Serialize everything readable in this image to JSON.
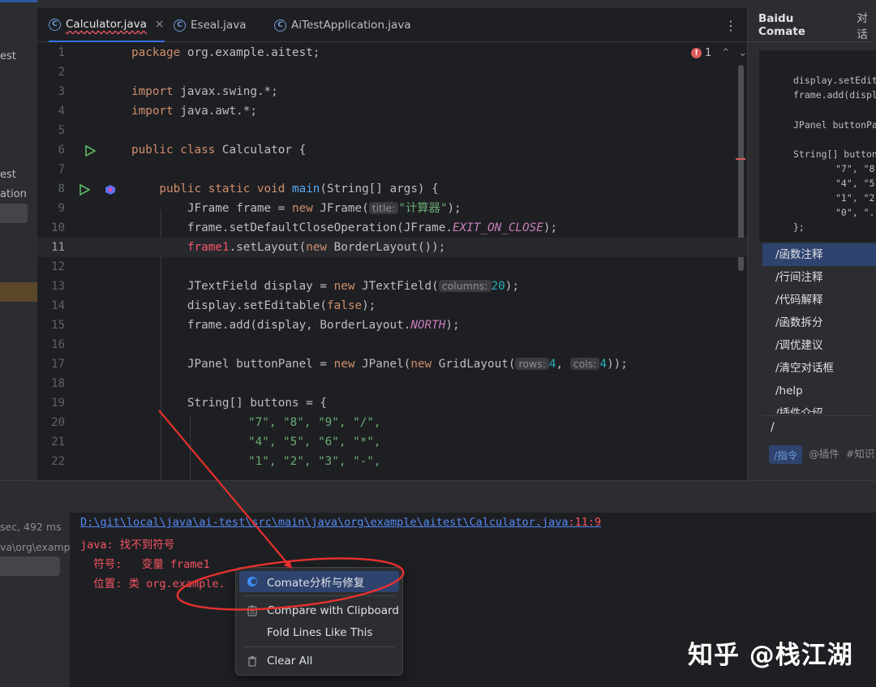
{
  "project_panel": {
    "items": [
      "est",
      "est",
      "ation"
    ]
  },
  "tabs": [
    {
      "label": "Calculator.java",
      "active": true,
      "has_error": true
    },
    {
      "label": "Eseal.java",
      "active": false,
      "has_error": false
    },
    {
      "label": "AiTestApplication.java",
      "active": false,
      "has_error": false
    }
  ],
  "editor": {
    "error_count": "1",
    "current_line": 11,
    "line_numbers": [
      "1",
      "2",
      "3",
      "4",
      "5",
      "6",
      "7",
      "8",
      "9",
      "10",
      "11",
      "12",
      "13",
      "14",
      "15",
      "16",
      "17",
      "18",
      "19",
      "20",
      "21",
      "22"
    ],
    "lines": {
      "l1a": "package",
      "l1b": " org.example.aitest;",
      "l3a": "import",
      "l3b": " javax.swing.*;",
      "l4a": "import",
      "l4b": " java.awt.*;",
      "l6a": "public class",
      "l6b": " Calculator {",
      "l8a": "    public static void ",
      "l8b": "main",
      "l8c": "(String[] args) {",
      "l9a": "        JFrame frame = ",
      "l9b": "new",
      "l9c": " JFrame(",
      "l9h": "title:",
      "l9s": "\"计算器\"",
      "l9d": ");",
      "l10a": "        frame.setDefaultCloseOperation(JFrame.",
      "l10b": "EXIT_ON_CLOSE",
      "l10c": ");",
      "l11a": "        ",
      "l11b": "frame1",
      "l11c": ".setLayout(",
      "l11d": "new",
      "l11e": " BorderLayout());",
      "l13a": "        JTextField display = ",
      "l13b": "new",
      "l13c": " JTextField(",
      "l13h": "columns:",
      "l13n": "20",
      "l13d": ");",
      "l14a": "        display.setEditable(",
      "l14b": "false",
      "l14c": ");",
      "l15a": "        frame.add(display, BorderLayout.",
      "l15b": "NORTH",
      "l15c": ");",
      "l17a": "        JPanel buttonPanel = ",
      "l17b": "new",
      "l17c": " JPanel(",
      "l17d": "new",
      "l17e": " GridLayout(",
      "l17h1": "rows:",
      "l17n1": "4",
      "l17m": ", ",
      "l17h2": "cols:",
      "l17n2": "4",
      "l17f": "));",
      "l19a": "        String[] buttons = {",
      "l20": "\"7\", \"8\", \"9\", \"/\",",
      "l21": "\"4\", \"5\", \"6\", \"*\",",
      "l22": "\"1\", \"2\", \"3\", \"-\","
    }
  },
  "right_panel": {
    "tab_active": "Baidu Comate",
    "tab_other": "对话",
    "code_lines": {
      "r1": "display.setEdita",
      "r1b": "frame.add(displa",
      "r2": "JPanel buttonPan",
      "r3": "String[] buttons",
      "r4": "\"7\", \"8\"",
      "r5": "\"4\", \"5\"",
      "r6": "\"1\", \"2\"",
      "r7": "\"0\", \".\"",
      "r8": "};"
    },
    "commands": [
      "/函数注释",
      "/行间注释",
      "/代码解释",
      "/函数拆分",
      "/调优建议",
      "/清空对话框",
      "/help",
      "/插件介绍"
    ],
    "input_value": "/",
    "chips": {
      "active": "/指令",
      "c2": "@插件",
      "c3": "#知识"
    }
  },
  "bottom_left": {
    "time": "sec, 492 ms",
    "path": "va\\org\\exampl"
  },
  "console": {
    "path_link": "D:\\git\\local\\java\\ai-test\\src\\main\\java\\org\\example\\aitest\\Calculator.java",
    "path_loc": ":11:9",
    "line2": "java: 找不到符号",
    "line3": "  符号:   变量 frame1",
    "line4": "  位置: 类 org.example."
  },
  "context_menu": {
    "items": [
      {
        "label": "Comate分析与修复",
        "icon": "comate-icon"
      },
      {
        "label": "Compare with Clipboard",
        "icon": "clipboard-icon"
      },
      {
        "label": "Fold Lines Like This",
        "icon": ""
      },
      {
        "label": "Clear All",
        "icon": "trash-icon"
      }
    ]
  },
  "annotation": {
    "color": "#e8312f"
  },
  "watermark": "知乎 @栈江湖",
  "colors": {
    "accent": "#3574f0",
    "selection": "#2e436e",
    "error": "#f75464",
    "keyword": "#cf8e6d",
    "string": "#6aab73"
  }
}
